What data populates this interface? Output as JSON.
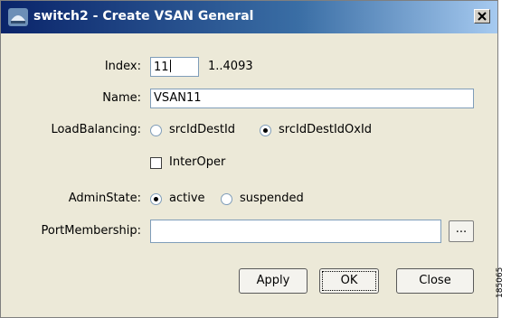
{
  "window": {
    "title": "switch2 - Create VSAN General",
    "icon": "switch-app-icon",
    "close_glyph": "×"
  },
  "form": {
    "index": {
      "label": "Index:",
      "value": "11",
      "range_hint": "1..4093"
    },
    "name": {
      "label": "Name:",
      "value": "VSAN11"
    },
    "load_balancing": {
      "label": "LoadBalancing:",
      "options": [
        "srcIdDestId",
        "srcIdDestIdOxId"
      ],
      "selected": "srcIdDestIdOxId"
    },
    "interoper": {
      "label": "InterOper",
      "checked": false
    },
    "admin_state": {
      "label": "AdminState:",
      "options": [
        "active",
        "suspended"
      ],
      "selected": "active"
    },
    "port_membership": {
      "label": "PortMembership:",
      "value": "",
      "browse_label": "..."
    }
  },
  "buttons": {
    "apply": "Apply",
    "ok": "OK",
    "close": "Close"
  },
  "figure_id": "185065",
  "colors": {
    "titlebar_start": "#0a246a",
    "titlebar_end": "#a6caf0",
    "dialog_bg": "#ece9d8"
  }
}
